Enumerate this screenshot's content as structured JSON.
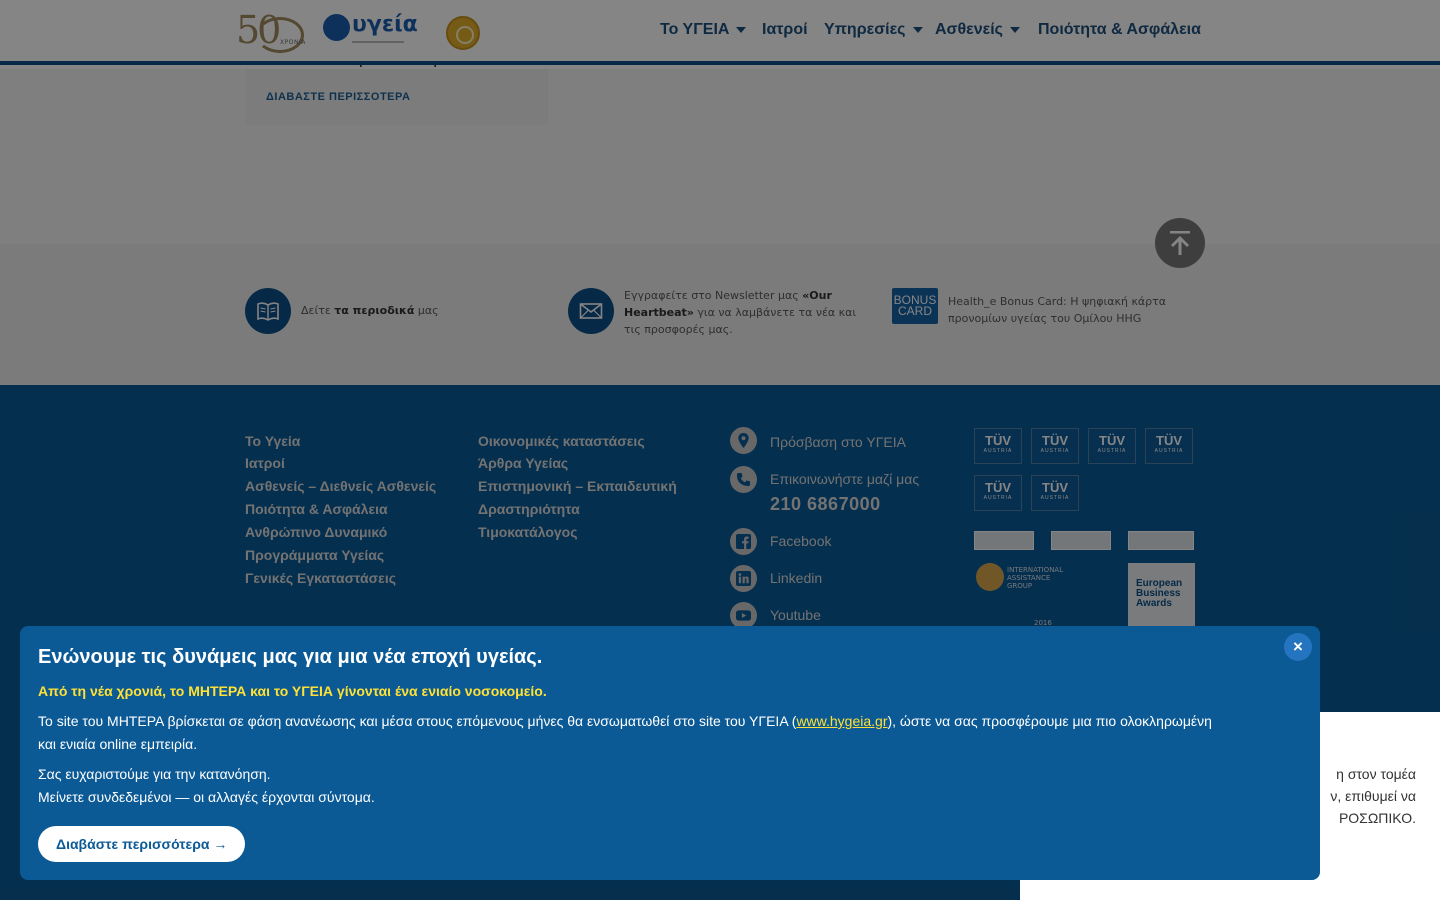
{
  "header": {
    "logo_50_number": "50",
    "logo_50_text": "ΧΡΟΝΙΑ",
    "logo_brand": "υγεία",
    "nav": [
      {
        "label": "Το ΥΓΕΙΑ",
        "dropdown": true
      },
      {
        "label": "Ιατροί",
        "dropdown": false
      },
      {
        "label": "Υπηρεσίες",
        "dropdown": true
      },
      {
        "label": "Ασθενείς",
        "dropdown": true
      },
      {
        "label": "Ποιότητα & Ασφάλεια",
        "dropdown": false
      }
    ]
  },
  "content": {
    "card_title": "Κοινωνική Ευθύνη",
    "card_link": "ΔΙΑΒΑΣΤΕ ΠΕΡΙΣΣΟΤΕΡΑ"
  },
  "features": [
    {
      "icon": "book-icon",
      "pre": "Δείτε ",
      "bold": "τα περιοδικά",
      "post": " μας"
    },
    {
      "icon": "envelope-icon",
      "pre": "Εγγραφείτε στο Newsletter μας ",
      "bold": "«Our Heartbeat»",
      "post": " για να λαμβάνετε τα νέα και τις προσφορές μας."
    },
    {
      "icon": "bonus-card-icon",
      "badge_line1": "BONUS",
      "badge_line2": "CARD",
      "text": "Health_e Bonus Card: Η ψηφιακή κάρτα προνομίων υγείας του Ομίλου HHG"
    }
  ],
  "footer": {
    "col1": [
      "Το Υγεία",
      "Ιατροί",
      "Ασθενείς – Διεθνείς Ασθενείς",
      "Ποιότητα & Ασφάλεια",
      "Ανθρώπινο Δυναμικό",
      "Προγράμματα Υγείας",
      "Γενικές Εγκαταστάσεις"
    ],
    "col2": [
      "Οικονομικές καταστάσεις",
      "Άρθρα Υγείας",
      "Επιστημονική – Εκπαιδευτική",
      "Δραστηριότητα",
      "Τιμοκατάλογος"
    ],
    "contact": {
      "access": "Πρόσβαση στο ΥΓΕΙΑ",
      "call": "Επικοινωνήστε μαζί μας",
      "phone": "210 6867000",
      "facebook": "Facebook",
      "linkedin": "Linkedin",
      "youtube": "Youtube"
    },
    "tuv_label": "TÜV",
    "tuv_sub": "AUSTRIA",
    "iag_text": "INTERNATIONAL ASSISTANCE GROUP",
    "eba_text": "European Business Awards",
    "year_badge": "2016"
  },
  "side_panel": {
    "lines": [
      "η στον τομέα",
      "ν, επιθυμεί να",
      "ΡΟΣΩΠΙΚΟ."
    ]
  },
  "modal": {
    "title": "Ενώνουμε τις δυνάμεις μας για μια νέα εποχή υγείας.",
    "highlight": "Από τη νέα χρονιά, το ΜΗΤΕΡΑ και το ΥΓΕΙΑ γίνονται ένα ενιαίο νοσοκομείο.",
    "body_pre": "Το site του ΜΗΤΕΡΑ βρίσκεται σε φάση ανανέωσης και μέσα στους επόμενους μήνες θα ενσωματωθεί στο site του ΥΓΕΙΑ (",
    "body_link": "www.hygeia.gr",
    "body_post": "), ώστε να σας προσφέρουμε μια πιο ολοκληρωμένη και ενιαία online εμπειρία.",
    "thanks": "Σας ευχαριστούμε για την κατανόηση.",
    "stay": "Μείνετε συνδεδεμένοι — οι αλλαγές έρχονται σύντομα.",
    "button": "Διαβάστε περισσότερα →",
    "close": "×"
  }
}
